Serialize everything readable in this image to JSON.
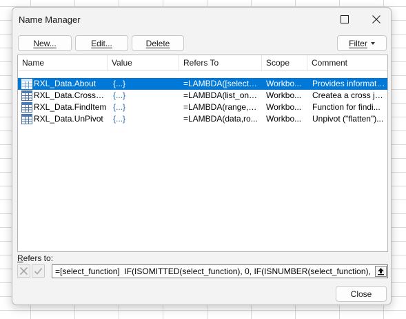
{
  "window": {
    "title": "Name Manager"
  },
  "toolbar": {
    "new_label": "New...",
    "edit_label": "Edit...",
    "delete_label": "Delete",
    "filter_label": "Filter"
  },
  "list": {
    "headers": {
      "name": "Name",
      "value": "Value",
      "refers_to": "Refers To",
      "scope": "Scope",
      "comment": "Comment"
    },
    "rows": [
      {
        "name": "RXL_Data.About",
        "value": "{...}",
        "refers_to": "=LAMBDA([select_f...",
        "scope": "Workbo...",
        "comment": "Provides informati...",
        "selected": true
      },
      {
        "name": "RXL_Data.CrossJoin",
        "value": "{...}",
        "refers_to": "=LAMBDA(list_one,...",
        "scope": "Workbo...",
        "comment": "Createa a cross joi...",
        "selected": false
      },
      {
        "name": "RXL_Data.FindItem",
        "value": "{...}",
        "refers_to": "=LAMBDA(range,fi...",
        "scope": "Workbo...",
        "comment": "Function for findi...",
        "selected": false
      },
      {
        "name": "RXL_Data.UnPivot",
        "value": "{...}",
        "refers_to": "=LAMBDA(data,ro...",
        "scope": "Workbo...",
        "comment": "Unpivot (\"flatten\")...",
        "selected": false
      }
    ]
  },
  "refers_to": {
    "label_underlined": "R",
    "label_rest": "efers to:",
    "formula": "=[select_function]  IF(ISOMITTED(select_function), 0, IF(ISNUMBER(select_function), INT(sel"
  },
  "footer": {
    "close_label": "Close"
  },
  "icons": {
    "name_icon": "range-name-icon",
    "cancel": "x-icon",
    "confirm": "check-icon",
    "collapse": "collapse-arrow-icon"
  },
  "colors": {
    "selection": "#0078d7",
    "dialog_bg": "#f3f3f3",
    "list_bg": "#ffffff"
  }
}
